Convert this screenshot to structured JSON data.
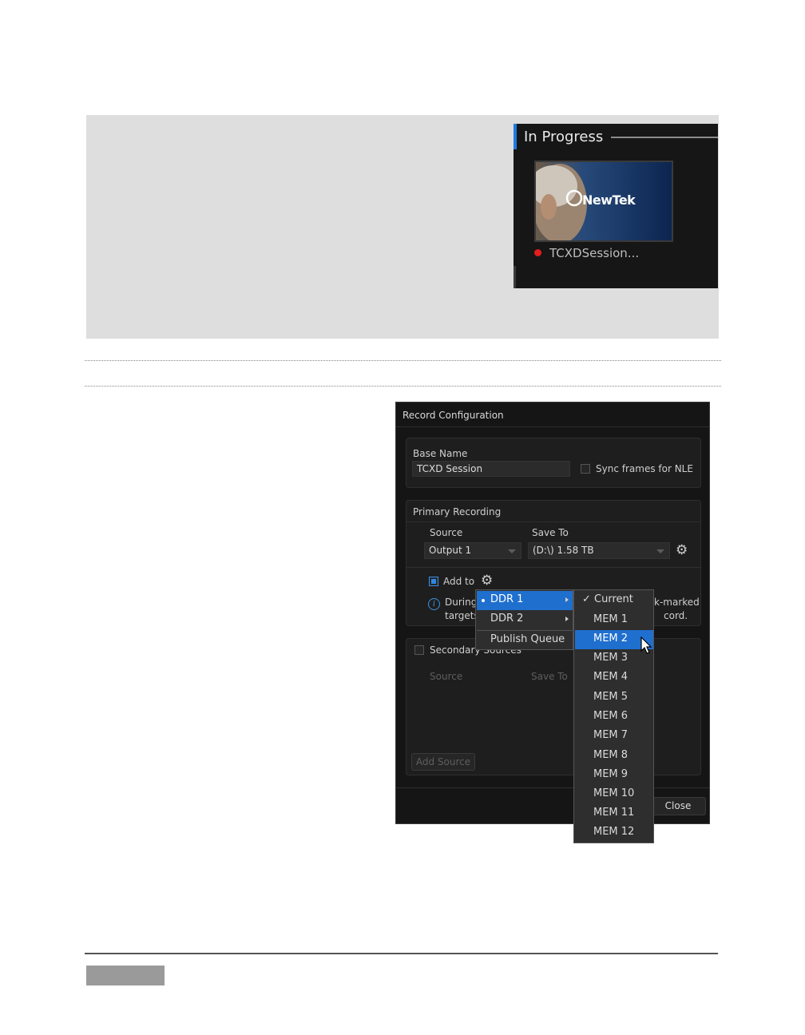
{
  "in_progress": {
    "title": "In Progress",
    "thumbnail_logo": "NewTek",
    "clip_name": "TCXDSession...",
    "status_color": "#e51d1d"
  },
  "dialog": {
    "title": "Record Configuration",
    "base_name_label": "Base Name",
    "base_name_value": "TCXD Session",
    "sync_label": "Sync frames for NLE",
    "primary_label": "Primary Recording",
    "source_label": "Source",
    "save_to_label": "Save To",
    "source_value": "Output 1",
    "save_to_value": "(D:\\) 1.58 TB",
    "add_to_label": "Add to",
    "info_line1_start": "During",
    "info_line1_end": "k-marked",
    "info_line2_start": "targets",
    "info_line2_end": "cord.",
    "secondary_label": "Secondary Sources",
    "secondary_source_label": "Source",
    "secondary_save_to_label": "Save To",
    "add_source_label": "Add Source",
    "close_label": "Close"
  },
  "menu_primary": {
    "items": [
      "DDR 1",
      "DDR 2",
      "Publish Queue"
    ],
    "selected": "DDR 1"
  },
  "menu_secondary": {
    "items": [
      "Current",
      "MEM 1",
      "MEM 2",
      "MEM 3",
      "MEM 4",
      "MEM 5",
      "MEM 6",
      "MEM 7",
      "MEM 8",
      "MEM 9",
      "MEM 10",
      "MEM 11",
      "MEM 12"
    ],
    "checked": "Current",
    "highlighted": "MEM 2"
  },
  "colors": {
    "accent": "#1f6fce",
    "dialog_bg": "#151515",
    "page_box": "#dedede"
  }
}
